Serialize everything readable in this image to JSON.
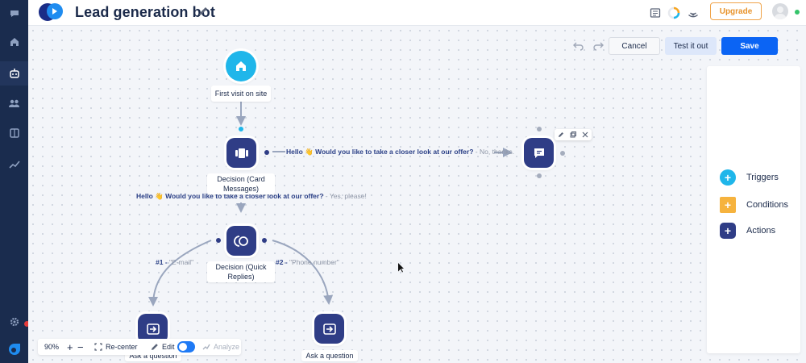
{
  "header": {
    "title": "Lead generation bot",
    "upgrade_label": "Upgrade"
  },
  "toolbar": {
    "cancel_label": "Cancel",
    "test_label": "Test it out",
    "save_label": "Save"
  },
  "panel": {
    "items": [
      {
        "label": "Triggers",
        "color": "#1fb6ea",
        "icon": "plus-icon"
      },
      {
        "label": "Conditions",
        "color": "#f6b33e",
        "icon": "plus-icon"
      },
      {
        "label": "Actions",
        "color": "#2f3d86",
        "icon": "plus-icon"
      }
    ]
  },
  "nodes": {
    "first_visit": "First visit on site",
    "decision_card": "Decision (Card Messages)",
    "decision_quick": "Decision (Quick Replies)",
    "ask_question_1": "Ask a question",
    "ask_question_2": "Ask a question"
  },
  "edges": {
    "hello_text": "Hello 👋 Would you like to take a closer look at our offer?",
    "no_thanks": "- No, thanks.",
    "yes_please": "- Yes, please!",
    "opt1_num": "#1 -",
    "opt1_val": "\"E-mail\"",
    "opt2_num": "#2 -",
    "opt2_val": "\"Phone number\""
  },
  "zoombar": {
    "zoom": "90%",
    "recenter": "Re-center",
    "edit": "Edit",
    "analyze": "Analyze"
  },
  "colors": {
    "primary": "#0b64f4",
    "node_blue": "#2f3d86",
    "trigger_cyan": "#1fb6ea",
    "upgrade_orange": "#e8932b",
    "rail": "#1a2c4e"
  }
}
